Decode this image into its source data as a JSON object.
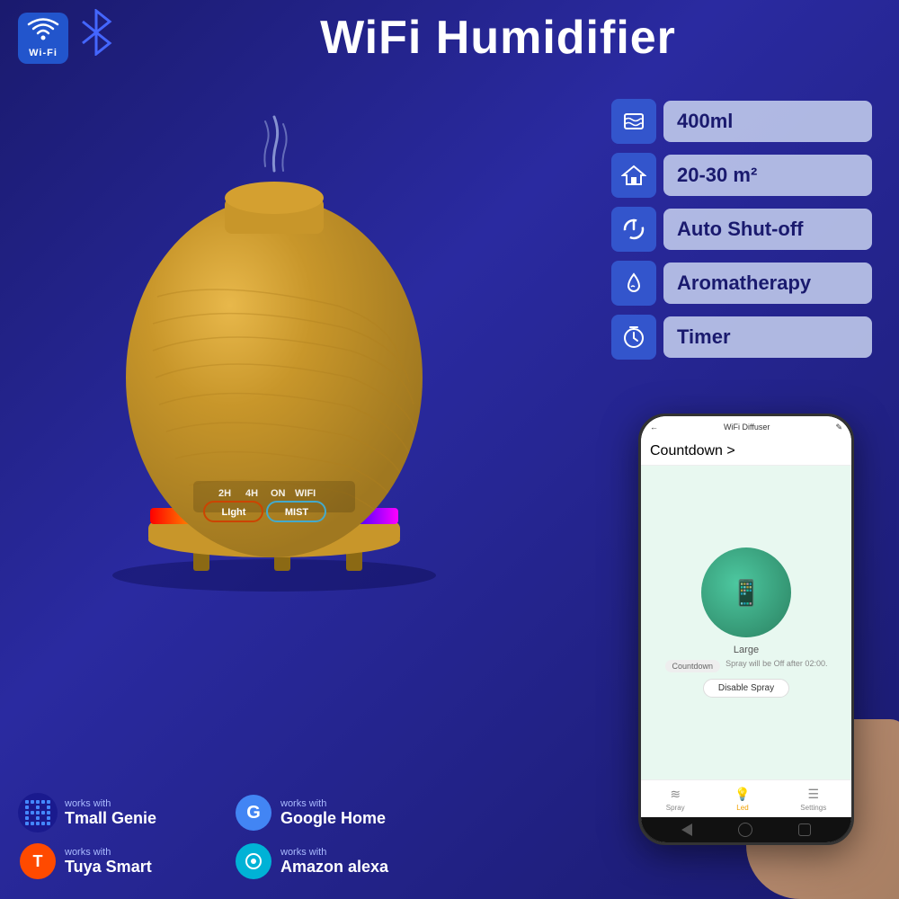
{
  "header": {
    "title": "WiFi Humidifier",
    "wifi_label": "Wi-Fi"
  },
  "features": [
    {
      "id": "capacity",
      "icon": "water-waves",
      "text": "400ml"
    },
    {
      "id": "coverage",
      "icon": "house",
      "text": "20-30 m²"
    },
    {
      "id": "shutoff",
      "icon": "power",
      "text": "Auto Shut-off"
    },
    {
      "id": "aromatherapy",
      "icon": "droplet",
      "text": "Aromatherapy"
    },
    {
      "id": "timer",
      "icon": "clock",
      "text": "Timer"
    }
  ],
  "product": {
    "button_light": "LIght",
    "button_mist": "MIST",
    "timer_labels": [
      "2H",
      "4H",
      "ON",
      "WIFI"
    ]
  },
  "compatible": [
    {
      "id": "tmall",
      "works_with": "works with",
      "name": "Tmall Genie",
      "color": "#4488ff"
    },
    {
      "id": "google",
      "works_with": "works with",
      "name": "Google Home",
      "color": "#4285F4"
    },
    {
      "id": "tuya",
      "works_with": "works with",
      "name": "Tuya Smart",
      "color": "#ff4a00"
    },
    {
      "id": "alexa",
      "works_with": "works with",
      "name": "Amazon alexa",
      "color": "#00b2d6"
    }
  ],
  "phone": {
    "title": "WiFi Diffuser",
    "countdown_label": "Countdown >",
    "size_label": "Large",
    "countdown_badge": "Countdown",
    "spray_off_text": "Spray will be Off after 02:00.",
    "disable_btn": "Disable Spray",
    "nav": {
      "spray": "Spray",
      "led": "Led",
      "settings": "Settings"
    }
  }
}
